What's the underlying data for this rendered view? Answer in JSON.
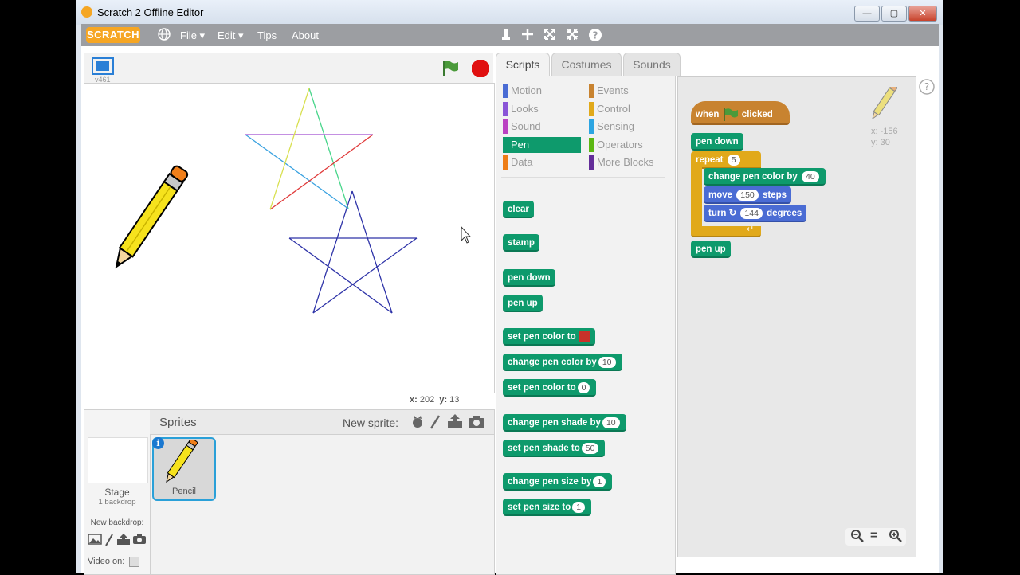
{
  "window": {
    "title": "Scratch 2 Offline Editor",
    "controls": {
      "minimize": "—",
      "maximize": "▢",
      "close": "✕"
    }
  },
  "menubar": {
    "logo": "SCRATCH",
    "items": [
      "File ▾",
      "Edit ▾",
      "Tips",
      "About"
    ],
    "icons": [
      "globe-icon",
      "duplicate-icon",
      "delete-icon",
      "grow-icon",
      "shrink-icon",
      "help-icon"
    ]
  },
  "stage": {
    "version": "v461",
    "mouse_x_label": "x:",
    "mouse_x": "202",
    "mouse_y_label": "y:",
    "mouse_y": "13"
  },
  "sprites": {
    "header": "Sprites",
    "new_sprite_label": "New sprite:",
    "stage_label": "Stage",
    "stage_sub": "1 backdrop",
    "new_backdrop_label": "New backdrop:",
    "video_label": "Video on:",
    "items": [
      {
        "name": "Pencil"
      }
    ]
  },
  "tabs": [
    "Scripts",
    "Costumes",
    "Sounds"
  ],
  "categories": [
    {
      "name": "Motion",
      "color": "#4a6cd4"
    },
    {
      "name": "Events",
      "color": "#c88330"
    },
    {
      "name": "Looks",
      "color": "#8a55d7"
    },
    {
      "name": "Control",
      "color": "#e1a91a"
    },
    {
      "name": "Sound",
      "color": "#bb42c3"
    },
    {
      "name": "Sensing",
      "color": "#2ca5e2"
    },
    {
      "name": "Pen",
      "color": "#0e9a6c"
    },
    {
      "name": "Operators",
      "color": "#5cb712"
    },
    {
      "name": "Data",
      "color": "#ee7d16"
    },
    {
      "name": "More Blocks",
      "color": "#632d99"
    }
  ],
  "palette_blocks": [
    {
      "text": "clear"
    },
    {
      "text": "stamp"
    },
    {
      "text": "pen down"
    },
    {
      "text": "pen up"
    },
    {
      "text": "set pen color to",
      "color_slot": "#c8322a"
    },
    {
      "text": "change pen color by",
      "slot": "10"
    },
    {
      "text": "set pen color to",
      "slot": "0"
    },
    {
      "text": "change pen shade by",
      "slot": "10"
    },
    {
      "text": "set pen shade to",
      "slot": "50"
    },
    {
      "text": "change pen size by",
      "slot": "1"
    },
    {
      "text": "set pen size to",
      "slot": "1"
    }
  ],
  "script": {
    "hat": {
      "when": "when",
      "clicked": "clicked"
    },
    "pen_down": "pen down",
    "repeat": {
      "label": "repeat",
      "count": "5"
    },
    "change_color": {
      "label": "change pen color by",
      "value": "40"
    },
    "move": {
      "label": "move",
      "value": "150",
      "suffix": "steps"
    },
    "turn": {
      "label": "turn",
      "value": "144",
      "suffix": "degrees"
    },
    "pen_up": "pen up"
  },
  "sprite_info": {
    "x": "x: -156",
    "y": "y: 30"
  },
  "zoom": {
    "out": "−",
    "reset": "=",
    "in": "+"
  }
}
